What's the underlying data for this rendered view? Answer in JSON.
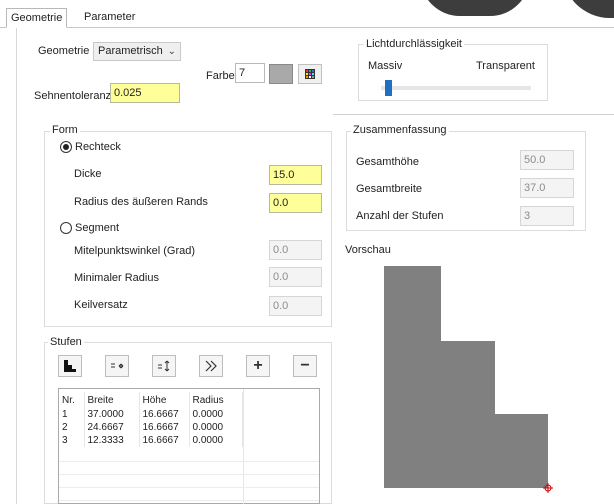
{
  "tabs": [
    {
      "label": "Geometrie",
      "active": true
    },
    {
      "label": "Parameter",
      "active": false
    }
  ],
  "geometry": {
    "label": "Geometrie",
    "selected": "Parametrisch",
    "farbe_label": "Farbe",
    "farbe_value": "7",
    "sehnentoleranz_label": "Sehnentoleranz",
    "sehnentoleranz_value": "0.025"
  },
  "transparency": {
    "title": "Lichtdurchlässigkeit",
    "left_label": "Massiv",
    "right_label": "Transparent",
    "level": 0.0
  },
  "form": {
    "title": "Form",
    "rechteck_label": "Rechteck",
    "rechteck_selected": true,
    "dicke_label": "Dicke",
    "dicke_value": "15.0",
    "radius_label": "Radius des äußeren Rands",
    "radius_value": "0.0",
    "segment_label": "Segment",
    "segment_selected": false,
    "mittelpunkt_label": "Mitelpunktswinkel (Grad)",
    "mittelpunkt_value": "0.0",
    "min_radius_label": "Minimaler Radius",
    "min_radius_value": "0.0",
    "keilversatz_label": "Keilversatz",
    "keilversatz_value": "0.0"
  },
  "summary": {
    "title": "Zusammenfassung",
    "gesamthoehe_label": "Gesamthöhe",
    "gesamthoehe_value": "50.0",
    "gesamtbreite_label": "Gesamtbreite",
    "gesamtbreite_value": "37.0",
    "stufen_label": "Anzahl der Stufen",
    "stufen_value": "3"
  },
  "preview": {
    "title": "Vorschau",
    "fill_color": "#808080",
    "marker_color": "#cc0000"
  },
  "stufen": {
    "title": "Stufen",
    "columns": [
      "Nr.",
      "Breite",
      "Höhe",
      "Radius"
    ],
    "rows": [
      [
        "1",
        "37.0000",
        "16.6667",
        "0.0000"
      ],
      [
        "2",
        "24.6667",
        "16.6667",
        "0.0000"
      ],
      [
        "3",
        "12.3333",
        "16.6667",
        "0.0000"
      ]
    ],
    "add_symbol": "+",
    "remove_symbol": "−"
  },
  "colors": {
    "yellow_field": "#ffff99",
    "swatch": "#a9a9a9",
    "slider_thumb": "#1f6fc2"
  }
}
